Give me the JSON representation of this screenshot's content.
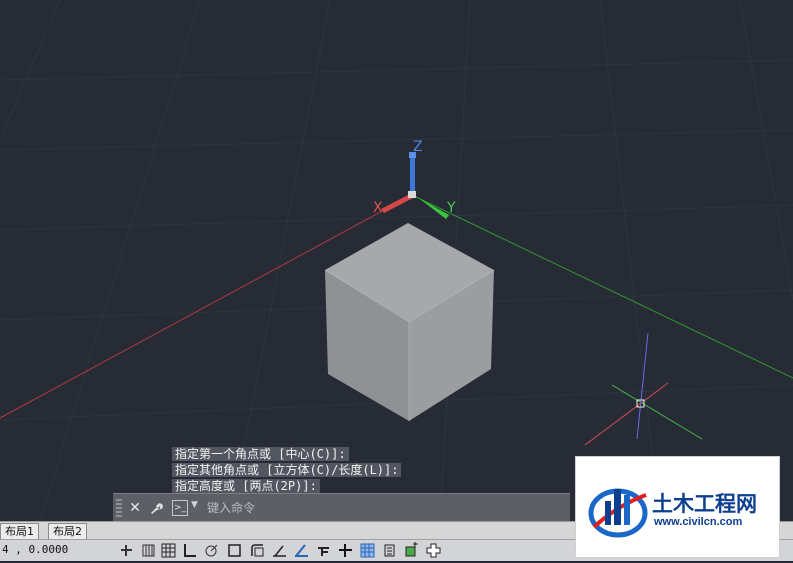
{
  "viewport": {
    "axis_labels": {
      "x": "X",
      "y": "Y",
      "z": "Z"
    }
  },
  "command_history": [
    "指定第一个角点或 [中心(C)]:",
    "指定其他角点或 [立方体(C)/长度(L)]:",
    "指定高度或 [两点(2P)]:"
  ],
  "command_bar": {
    "placeholder": "键入命令",
    "close_icon": "close-icon",
    "customize_icon": "wrench-icon",
    "prompt_icon": "command-prompt-icon"
  },
  "layout_tabs": [
    "布局1",
    "布局2"
  ],
  "status": {
    "coordinates": "4  , 0.0000",
    "tools": [
      "snap-mode",
      "grid-display",
      "ortho-mode",
      "polar-tracking",
      "object-snap",
      "3d-object-snap",
      "object-snap-tracking",
      "dynamic-ucs",
      "dynamic-input",
      "lineweight",
      "transparency",
      "quick-properties",
      "selection-cycling"
    ]
  },
  "watermark": {
    "title": "土木工程网",
    "url": "www.civilcn.com"
  },
  "colors": {
    "viewport_bg": "#262b35",
    "x_axis": "#e04040",
    "y_axis": "#3cc83c",
    "z_axis": "#3c78d8",
    "cube_top": "#a5a9ab",
    "cube_left": "#8e9294",
    "cube_right": "#9a9ea0",
    "watermark_blue": "#0d3f8f"
  }
}
